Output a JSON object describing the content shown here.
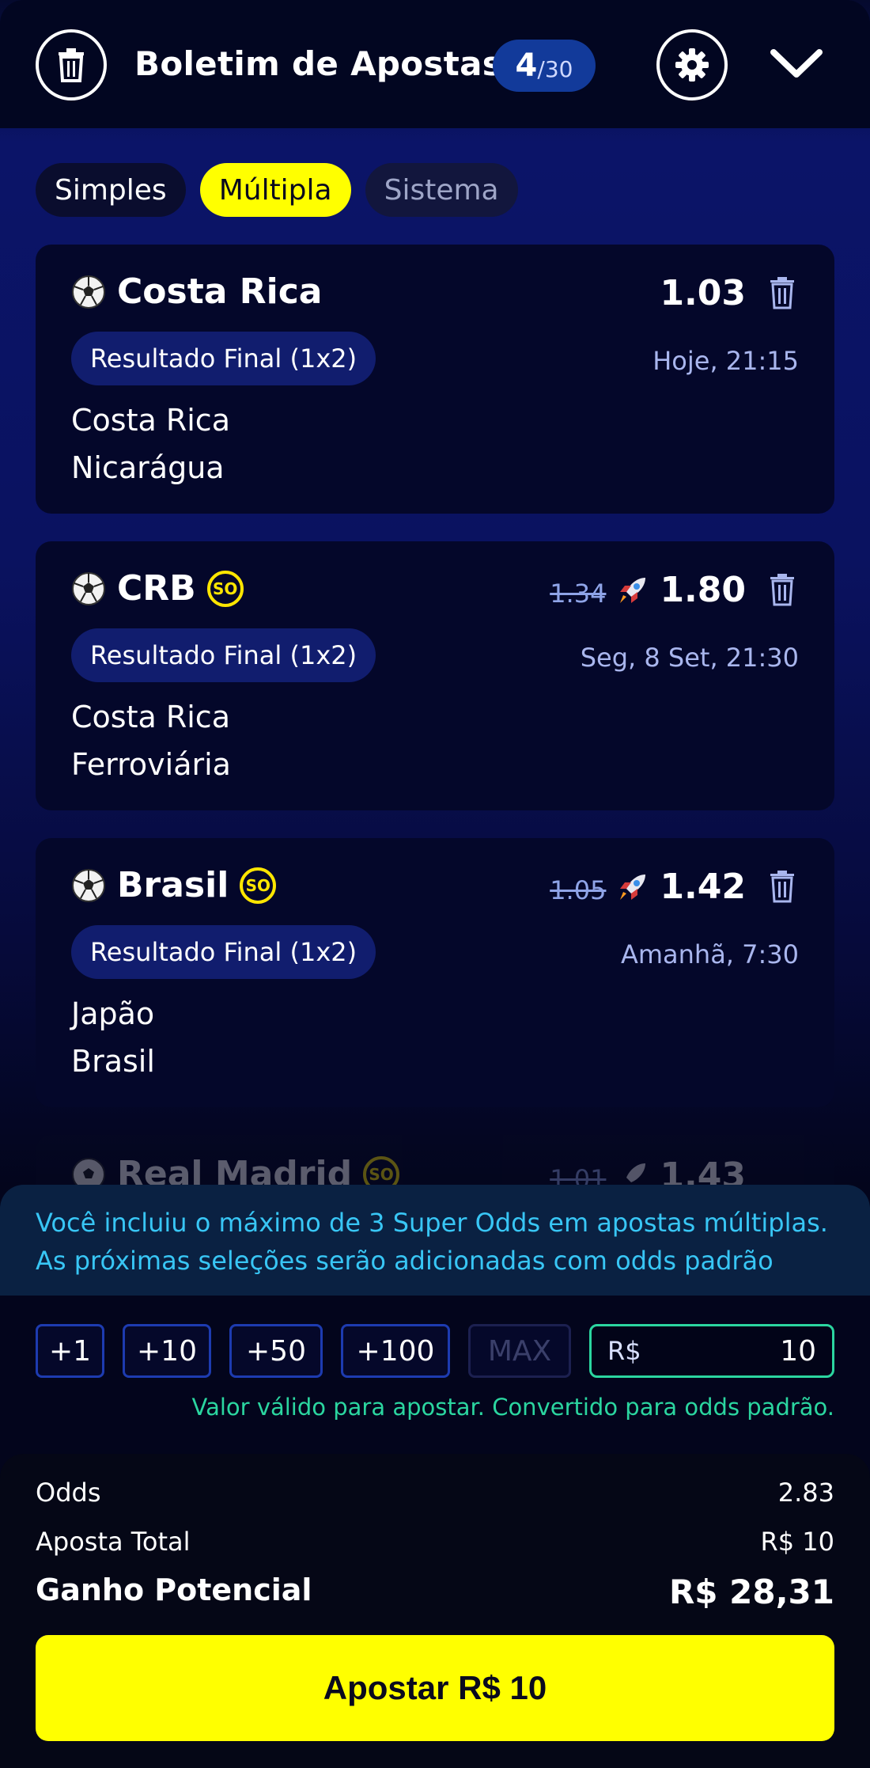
{
  "header": {
    "title": "Boletim de Apostas",
    "count": "4",
    "max": "/30"
  },
  "tabs": [
    {
      "label": "Simples"
    },
    {
      "label": "Múltipla"
    },
    {
      "label": "Sistema"
    }
  ],
  "selections": [
    {
      "team": "Costa Rica",
      "odd": "1.03",
      "old_odd": "",
      "super_odd": false,
      "market": "Resultado Final (1x2)",
      "time": "Hoje, 21:15",
      "home": "Costa Rica",
      "away": "Nicarágua"
    },
    {
      "team": "CRB",
      "odd": "1.80",
      "old_odd": "1.34",
      "super_odd": true,
      "market": "Resultado Final (1x2)",
      "time": "Seg, 8 Set, 21:30",
      "home": "Costa Rica",
      "away": "Ferroviária"
    },
    {
      "team": "Brasil",
      "odd": "1.42",
      "old_odd": "1.05",
      "super_odd": true,
      "market": "Resultado Final (1x2)",
      "time": "Amanhã, 7:30",
      "home": "Japão",
      "away": "Brasil"
    },
    {
      "team": "Real Madrid",
      "odd": "1.43",
      "old_odd": "1.01",
      "super_odd": true
    }
  ],
  "super_odd_badge": "SO",
  "notice": {
    "line1": "Você incluiu o máximo de 3 Super Odds em apostas múltiplas.",
    "line2": "As próximas seleções serão adicionadas com odds padrão"
  },
  "quick_stakes": [
    "+1",
    "+10",
    "+50",
    "+100",
    "MAX"
  ],
  "stake": {
    "currency": "R$",
    "value": "10"
  },
  "valid_message": "Valor válido para apostar. Convertido para odds padrão.",
  "summary": {
    "odds_label": "Odds",
    "odds_value": "2.83",
    "total_label": "Aposta Total",
    "total_value": "R$ 10",
    "gain_label": "Ganho Potencial",
    "gain_value": "R$ 28,31"
  },
  "bet_button": "Apostar R$ 10",
  "colors": {
    "accent": "#ffff00",
    "success": "#2bd6a0",
    "info": "#38c6f5",
    "badge": "#123a9a"
  }
}
